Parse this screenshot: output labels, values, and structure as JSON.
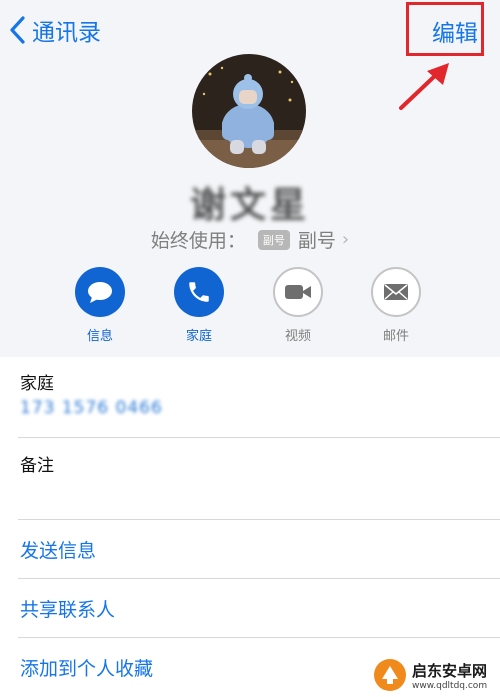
{
  "nav": {
    "back_label": "通讯录",
    "edit_label": "编辑"
  },
  "contact": {
    "name": "谢文星",
    "preferred_prefix": "始终使用：",
    "line_badge": "副号",
    "line_label": "副号"
  },
  "actions": [
    {
      "label": "信息",
      "icon": "message-icon",
      "active": true
    },
    {
      "label": "家庭",
      "icon": "phone-icon",
      "active": true
    },
    {
      "label": "视频",
      "icon": "video-icon",
      "active": false
    },
    {
      "label": "邮件",
      "icon": "mail-icon",
      "active": false
    }
  ],
  "fields": {
    "phone_label": "家庭",
    "phone_value": "173 1576 0466",
    "notes_label": "备注"
  },
  "links": [
    "发送信息",
    "共享联系人",
    "添加到个人收藏"
  ],
  "watermark": {
    "title": "启东安卓网",
    "url": "www.qdltdq.com"
  },
  "colors": {
    "accent": "#1676e8",
    "action_fill": "#1165d3",
    "annotation": "#e1262c",
    "header_bg": "#f3f5f8"
  }
}
